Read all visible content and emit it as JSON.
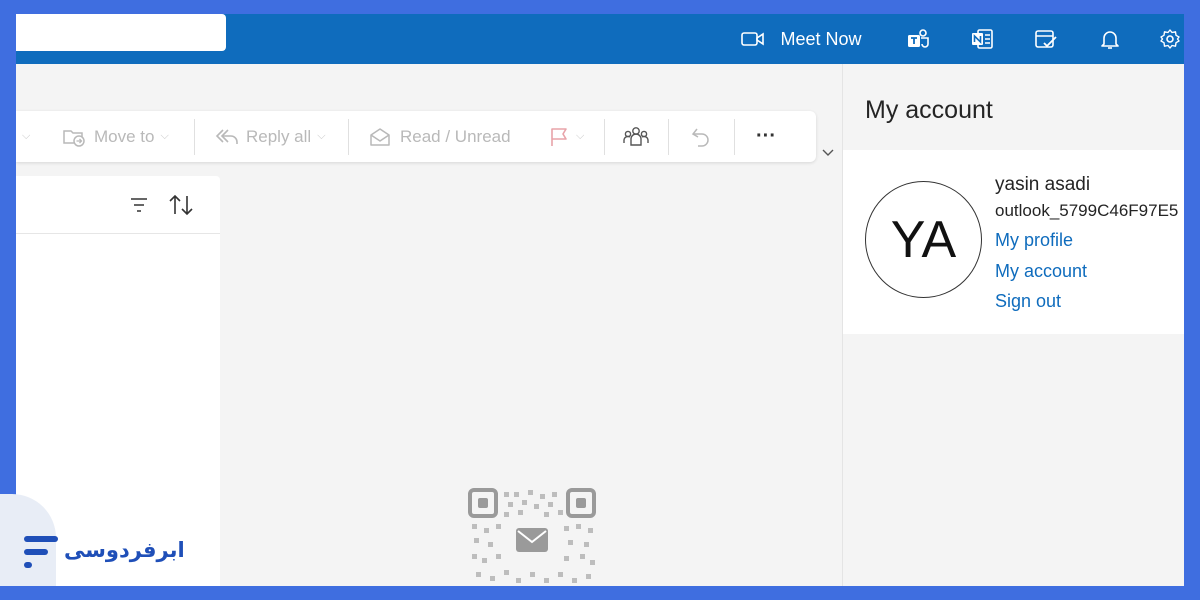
{
  "topbar": {
    "search": {
      "placeholder": ""
    },
    "meet_now_label": "Meet Now",
    "icons": [
      "video-camera-icon",
      "teams-icon",
      "onenote-icon",
      "to-do-icon",
      "bell-icon",
      "gear-icon"
    ]
  },
  "toolbar": {
    "move_to_label": "Move to",
    "reply_all_label": "Reply all",
    "read_unread_label": "Read / Unread",
    "more_label": "···"
  },
  "side_panel": {
    "title": "My account",
    "account": {
      "initials": "YA",
      "name": "yasin asadi",
      "email": "outlook_5799C46F97E5",
      "links": {
        "my_profile": "My profile",
        "my_account": "My account",
        "sign_out": "Sign out"
      }
    }
  },
  "brand": {
    "name": "ابرفردوسی",
    "color": "#1f4fb8"
  },
  "colors": {
    "accent": "#0f6cbd",
    "frame": "#3f6ee0",
    "flag": "#e8a3a9"
  }
}
